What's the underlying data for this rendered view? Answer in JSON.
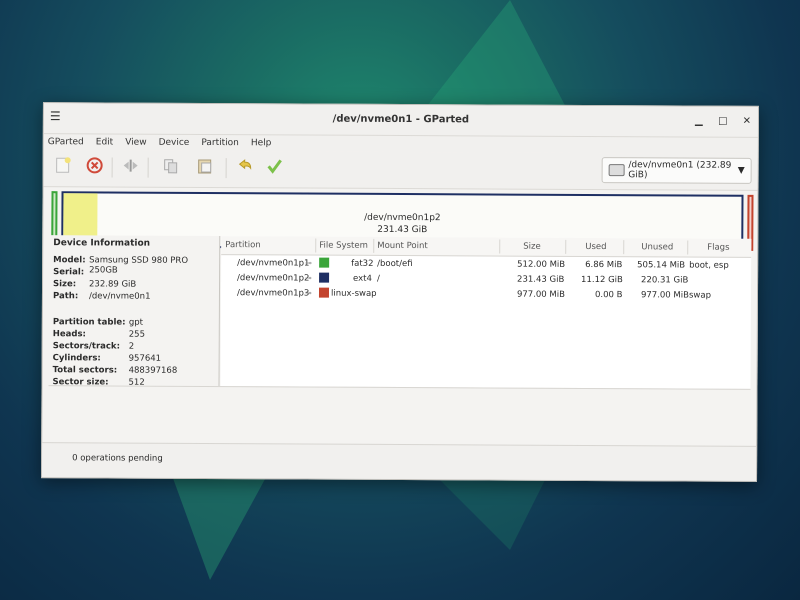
{
  "window": {
    "title": "/dev/nvme0n1 - GParted",
    "controls": {
      "minimize": "▁",
      "maximize": "□",
      "close": "✕"
    }
  },
  "menu": [
    "GParted",
    "Edit",
    "View",
    "Device",
    "Partition",
    "Help"
  ],
  "toolbar": {
    "icons": [
      "new-partition-icon",
      "delete-icon",
      "resize-move-icon",
      "copy-icon",
      "paste-icon",
      "undo-icon",
      "apply-icon"
    ],
    "device_selector": "/dev/nvme0n1 (232.89 GiB)"
  },
  "disk_bar": {
    "selected_partition": "/dev/nvme0n1p2",
    "selected_size": "231.43 GiB",
    "used_fraction": 0.048,
    "colors": {
      "fat32": "#3aa53a",
      "ext4": "#1e2f63",
      "linux-swap": "#c3442e",
      "used": "#f0f08a"
    }
  },
  "device_info": {
    "heading": "Device Information",
    "labels": {
      "model": "Model:",
      "serial": "Serial:",
      "size": "Size:",
      "path": "Path:",
      "partition_table": "Partition table:",
      "heads": "Heads:",
      "sectors_track": "Sectors/track:",
      "cylinders": "Cylinders:",
      "total_sectors": "Total sectors:",
      "sector_size": "Sector size:"
    },
    "values": {
      "model": "Samsung SSD 980 PRO 250GB",
      "serial": "",
      "size": "232.89 GiB",
      "path": "/dev/nvme0n1",
      "partition_table": "gpt",
      "heads": "255",
      "sectors_track": "2",
      "cylinders": "957641",
      "total_sectors": "488397168",
      "sector_size": "512"
    }
  },
  "table": {
    "columns": [
      "Partition",
      "File System",
      "Mount Point",
      "Size",
      "Used",
      "Unused",
      "Flags"
    ],
    "rows": [
      {
        "partition": "/dev/nvme0n1p1",
        "fs": "fat32",
        "fs_color": "#3aa53a",
        "mount": "/boot/efi",
        "size": "512.00 MiB",
        "used": "6.86 MiB",
        "unused": "505.14 MiB",
        "flags": "boot, esp"
      },
      {
        "partition": "/dev/nvme0n1p2",
        "fs": "ext4",
        "fs_color": "#1e2f63",
        "mount": "/",
        "size": "231.43 GiB",
        "used": "11.12 GiB",
        "unused": "220.31 GiB",
        "flags": ""
      },
      {
        "partition": "/dev/nvme0n1p3",
        "fs": "linux-swap",
        "fs_color": "#c3442e",
        "mount": "",
        "size": "977.00 MiB",
        "used": "0.00 B",
        "unused": "977.00 MiB",
        "flags": "swap"
      }
    ]
  },
  "status": {
    "text": "0 operations pending"
  }
}
